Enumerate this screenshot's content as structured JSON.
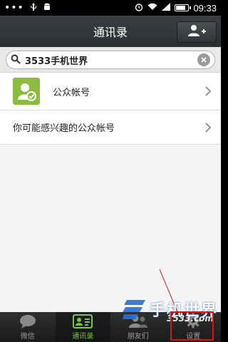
{
  "status_bar": {
    "time": "09:33",
    "battery_level": 0.85
  },
  "header": {
    "title": "通讯录"
  },
  "search": {
    "value": "3533手机世界"
  },
  "list": [
    {
      "label": "公众帐号"
    },
    {
      "label": "你可能感兴趣的公众帐号"
    }
  ],
  "tabs": [
    {
      "label": "微信",
      "icon": "chat-bubble-icon",
      "active": false
    },
    {
      "label": "通讯录",
      "icon": "contacts-card-icon",
      "active": true
    },
    {
      "label": "朋友们",
      "icon": "friends-icon",
      "active": false
    },
    {
      "label": "设置",
      "icon": "gear-icon",
      "active": false
    }
  ],
  "watermark": {
    "title": "手机世界",
    "url": "3533.com"
  },
  "colors": {
    "accent": "#7cc53a",
    "header": "#2b2e31",
    "highlight": "#e01010",
    "account_icon": "#8cbc3e"
  }
}
